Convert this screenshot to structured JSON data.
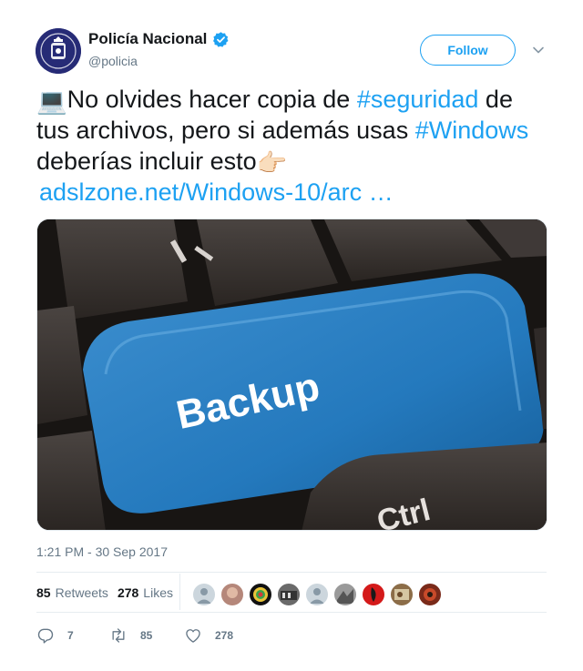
{
  "account": {
    "name": "Policía Nacional",
    "handle": "@policia"
  },
  "follow_label": "Follow",
  "tweet": {
    "emoji_laptop": "💻",
    "line1_text": "No olvides hacer copia de ",
    "hashtag1": "#seguridad",
    "line1_end": " de",
    "line2_text": "tus archivos, pero si además usas ",
    "hashtag2": "#Windows",
    "line3_text": "deberías incluir esto",
    "emoji_point": "👉🏻",
    "link": "adslzone.net/Windows-10/arc …"
  },
  "media": {
    "key_label": "Backup",
    "ctrl_label": "Ctrl"
  },
  "timestamp": "1:21 PM - 30 Sep 2017",
  "stats": {
    "retweets_count": "85",
    "retweets_label": "Retweets",
    "likes_count": "278",
    "likes_label": "Likes"
  },
  "actions": {
    "reply_count": "7",
    "retweet_count": "85",
    "like_count": "278"
  },
  "colors": {
    "accent": "#1da1f2",
    "text": "#14171a",
    "muted": "#657786"
  },
  "icons": [
    "verified-badge-icon",
    "chevron-down-icon",
    "reply-icon",
    "retweet-icon",
    "heart-icon"
  ]
}
